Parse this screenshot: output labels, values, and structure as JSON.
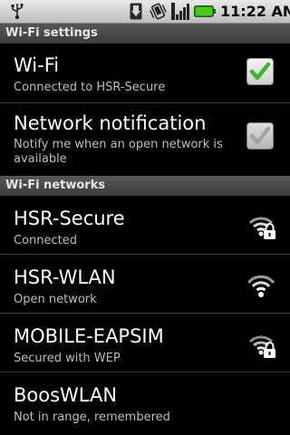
{
  "status_bar": {
    "time": "11:22 AM",
    "icons": [
      "usb-icon",
      "download-icon",
      "vibrate-icon",
      "signal-icon",
      "battery-icon"
    ]
  },
  "sections": {
    "wifi_settings": "Wi-Fi settings",
    "wifi_networks": "Wi-Fi networks"
  },
  "settings": [
    {
      "title": "Wi-Fi",
      "summary": "Connected to HSR-Secure",
      "checked": true
    },
    {
      "title": "Network notification",
      "summary": "Notify me when an open network is available",
      "checked": false
    }
  ],
  "networks": [
    {
      "ssid": "HSR-Secure",
      "status": "Connected",
      "secured": true,
      "in_range": true
    },
    {
      "ssid": "HSR-WLAN",
      "status": "Open network",
      "secured": false,
      "in_range": true
    },
    {
      "ssid": "MOBILE-EAPSIM",
      "status": "Secured with WEP",
      "secured": true,
      "in_range": true
    },
    {
      "ssid": "BoosWLAN",
      "status": "Not in range, remembered",
      "secured": false,
      "in_range": false
    }
  ],
  "colors": {
    "checkmark_on": "#3bb52c",
    "checkmark_off": "#a3a3a3",
    "section_bg": "#4a4a4a",
    "status_bar_bg": "#d6d6d6"
  }
}
